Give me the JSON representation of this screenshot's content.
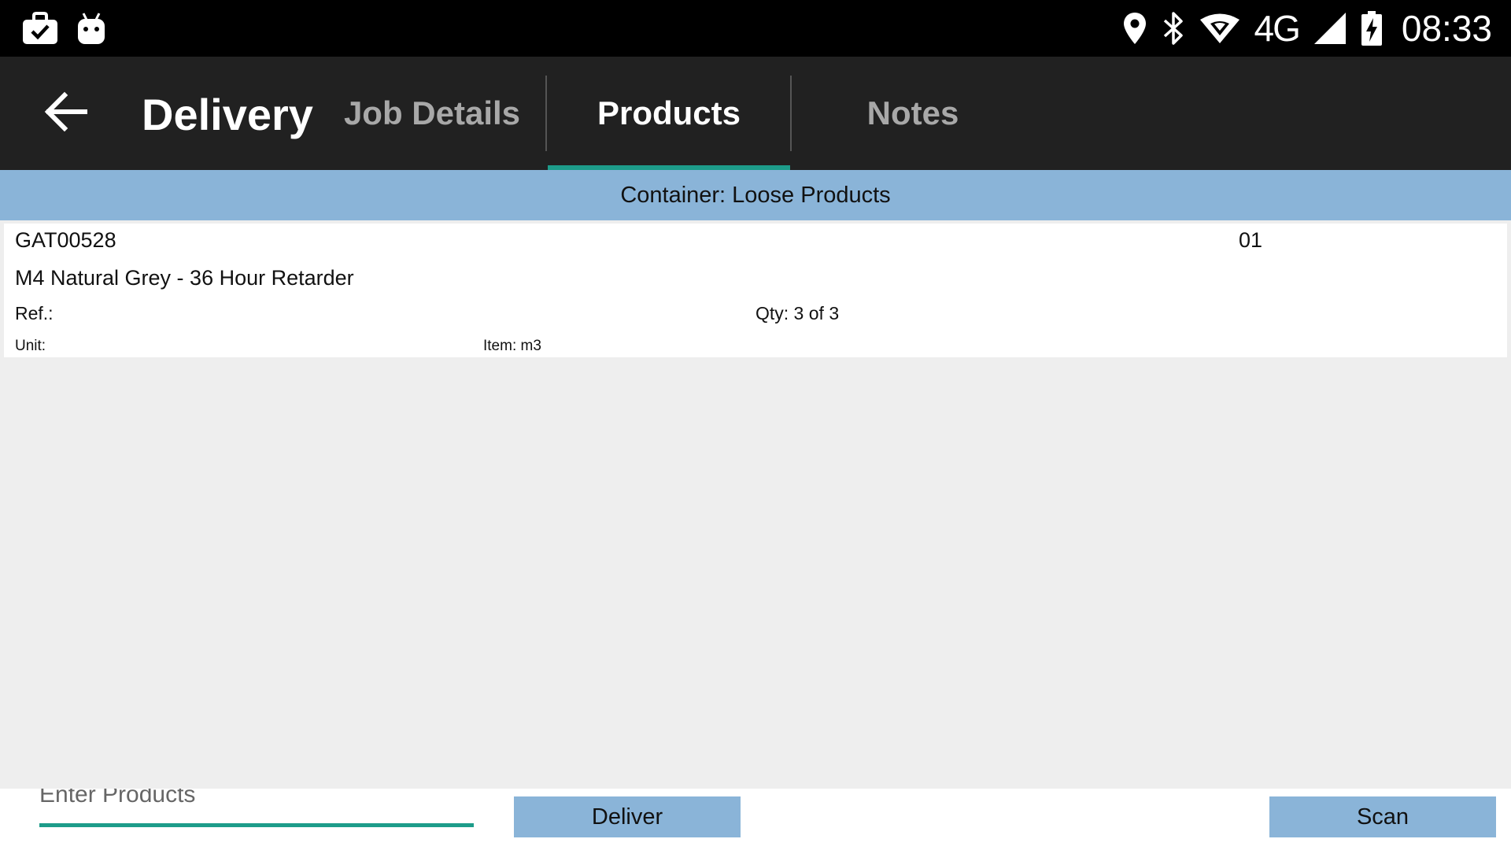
{
  "status_bar": {
    "left_icons": [
      "briefcase-check-icon",
      "android-robot-icon"
    ],
    "right_icons": [
      "location-pin-icon",
      "bluetooth-icon",
      "wifi-icon",
      "cell-signal-icon",
      "battery-charging-icon"
    ],
    "network": "4G",
    "time": "08:33"
  },
  "app_bar": {
    "title": "Delivery",
    "tabs": [
      {
        "label": "Job Details",
        "active": false
      },
      {
        "label": "Products",
        "active": true
      },
      {
        "label": "Notes",
        "active": false
      }
    ],
    "accent_color": "#1d9c8a",
    "background": "#212121"
  },
  "container_header": {
    "text": "Container: Loose Products",
    "background": "#8ab4d8"
  },
  "products": [
    {
      "code": "GAT00528",
      "sequence": "01",
      "description": "M4 Natural Grey - 36 Hour Retarder",
      "ref": "Ref.:",
      "qty": "Qty: 3 of 3",
      "unit": "Unit:",
      "item": "Item: m3"
    }
  ],
  "bottom_bar": {
    "input_placeholder": "Enter Products",
    "deliver_label": "Deliver",
    "scan_label": "Scan"
  }
}
